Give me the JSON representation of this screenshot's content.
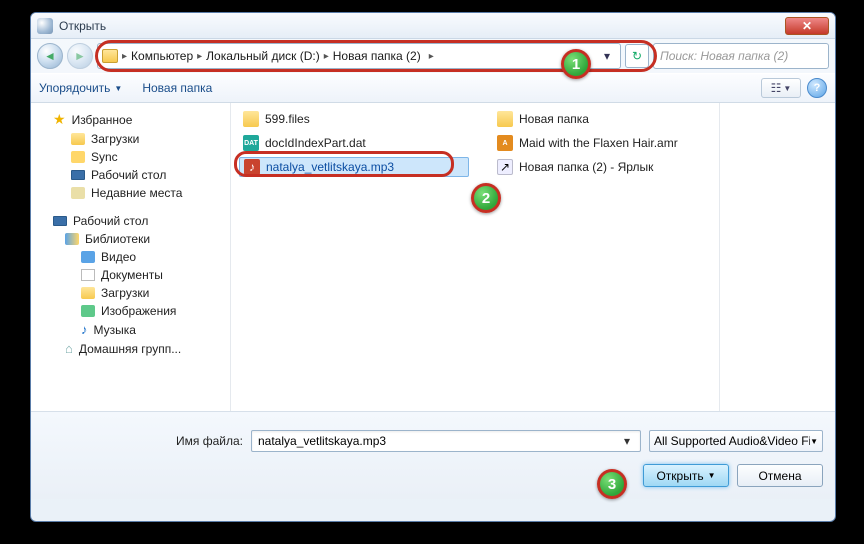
{
  "title": "Открыть",
  "breadcrumb": [
    "Компьютер",
    "Локальный диск (D:)",
    "Новая папка (2)"
  ],
  "search_placeholder": "Поиск: Новая папка (2)",
  "toolbar": {
    "organize": "Упорядочить",
    "new_folder": "Новая папка"
  },
  "sidebar": {
    "favorites": "Избранное",
    "fav_items": [
      "Загрузки",
      "Sync",
      "Рабочий стол",
      "Недавние места"
    ],
    "desktop": "Рабочий стол",
    "libraries": "Библиотеки",
    "lib_items": [
      "Видео",
      "Документы",
      "Загрузки",
      "Изображения",
      "Музыка"
    ],
    "homegroup": "Домашняя групп..."
  },
  "files_left": [
    {
      "name": "599.files",
      "type": "folder"
    },
    {
      "name": "docIdIndexPart.dat",
      "type": "dat"
    },
    {
      "name": "natalya_vetlitskaya.mp3",
      "type": "mp3",
      "selected": true
    }
  ],
  "files_right": [
    {
      "name": "Новая папка",
      "type": "folder"
    },
    {
      "name": "Maid with the Flaxen Hair.amr",
      "type": "amr"
    },
    {
      "name": "Новая папка (2) - Ярлык",
      "type": "lnk"
    }
  ],
  "filename": {
    "label": "Имя файла:",
    "value": "natalya_vetlitskaya.mp3"
  },
  "filter": "All Supported Audio&Video Fil",
  "buttons": {
    "open": "Открыть",
    "cancel": "Отмена"
  },
  "annot": {
    "b1": "1",
    "b2": "2",
    "b3": "3"
  }
}
